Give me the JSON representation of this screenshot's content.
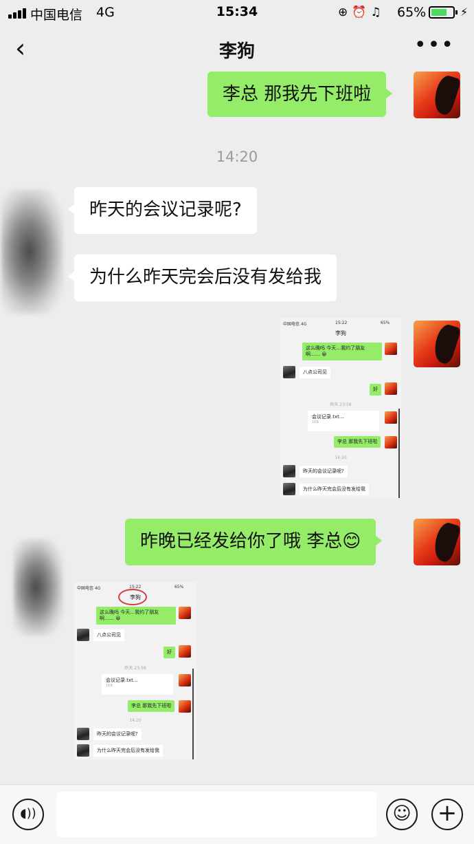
{
  "status_bar": {
    "carrier": "中国电信",
    "network": "4G",
    "time": "15:34",
    "icons": [
      "orientation-lock-icon",
      "alarm-icon",
      "headphones-icon"
    ],
    "battery_percent": "65%"
  },
  "nav": {
    "back_icon": "chevron-left-icon",
    "title": "李狗",
    "more_icon": "more-dots-icon"
  },
  "messages": [
    {
      "from": "me",
      "text": "李总 那我先下班啦"
    },
    {
      "timestamp": "14:20"
    },
    {
      "from": "other",
      "text": "昨天的会议记录呢?"
    },
    {
      "from": "other",
      "text": "为什么昨天完会后没有发给我"
    },
    {
      "from": "me",
      "type": "image"
    },
    {
      "from": "me",
      "text": "昨晚已经发给你了哦 李总😊"
    },
    {
      "from": "other",
      "type": "image"
    }
  ],
  "shot1": {
    "carrier": "中国电信 4G",
    "time": "15:22",
    "battery": "65%",
    "title": "李狗",
    "msg1": "这么晚吗 今天…我约了朋友啊…… 😀",
    "msg2": "八点公司见",
    "msg3": "好",
    "ts1": "昨天 23:58",
    "file_name": "会议记录.txt...",
    "file_size": "1KB",
    "msg4": "李总 那我先下班啦",
    "ts2": "14:20",
    "msg5": "昨天的会议记录呢?",
    "msg6": "为什么昨天完会后没有发给我"
  },
  "shot2": {
    "carrier": "中国电信 4G",
    "time": "15:22",
    "battery": "65%",
    "title": "李狗",
    "msg1": "这么晚吗 今天…我约了朋友啊…… 😀",
    "msg2": "八点公司见",
    "msg3": "好",
    "ts1": "昨天 23:58",
    "file_name": "会议记录.txt...",
    "file_size": "1KB",
    "msg4": "李总 那我先下班啦",
    "ts2": "14:20",
    "msg5": "昨天的会议记录呢?",
    "msg6": "为什么昨天完会后没有发给我"
  },
  "input_bar": {
    "voice_icon": "voice-icon",
    "emoji_icon": "emoji-icon",
    "plus_icon": "plus-icon"
  },
  "colors": {
    "my_bubble": "#95ec69",
    "other_bubble": "#ffffff",
    "background": "#ededed"
  }
}
